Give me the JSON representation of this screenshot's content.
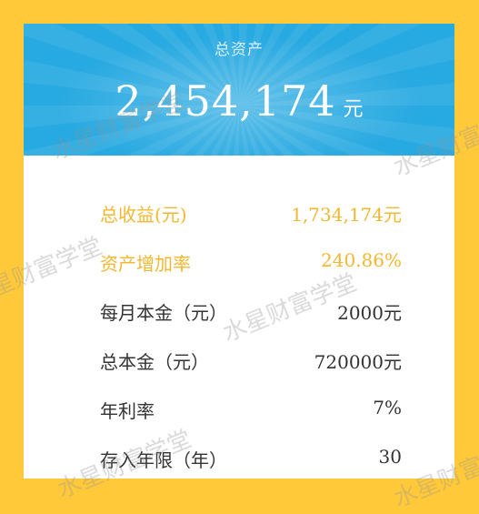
{
  "header": {
    "title": "总资产",
    "amount": "2,454,174",
    "unit": "元"
  },
  "rows": [
    {
      "label": "总收益(元)",
      "value": "1,734,174元",
      "highlight": true
    },
    {
      "label": "资产增加率",
      "value": "240.86%",
      "highlight": true
    },
    {
      "label": "每月本金（元）",
      "value": "2000元",
      "highlight": false
    },
    {
      "label": "总本金（元）",
      "value": "720000元",
      "highlight": false
    },
    {
      "label": "年利率",
      "value": "7%",
      "highlight": false
    },
    {
      "label": "存入年限（年）",
      "value": "30",
      "highlight": false
    }
  ],
  "watermark": "水星财富学堂",
  "colors": {
    "background": "#ffc93a",
    "header": "#27a9e1",
    "highlight_text": "#f4b731",
    "text": "#333333"
  }
}
